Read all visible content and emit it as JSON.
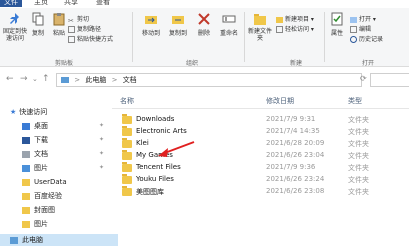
{
  "menu": {
    "tabs": [
      "文件",
      "主页",
      "共享",
      "查看"
    ]
  },
  "ribbon": {
    "pin_label": "固定到快速访问",
    "copy_label": "复制",
    "paste_label": "粘贴",
    "copy_path_label": "复制路径",
    "paste_shortcut_label": "粘贴快捷方式",
    "cut_label": "剪切",
    "clipboard_group": "剪贴板",
    "move_to_label": "移动到",
    "copy_to_label": "复制到",
    "delete_label": "删除",
    "rename_label": "重命名",
    "organize_group": "组织",
    "new_folder_label": "新建文件夹",
    "new_item_label": "新建项目",
    "easy_access_label": "轻松访问",
    "new_group": "新建",
    "properties_label": "属性",
    "open_label": "打开",
    "edit_label": "编辑",
    "history_label": "历史记录",
    "open_group": "打开"
  },
  "address": {
    "path1": "此电脑",
    "path2": "文档",
    "separator": ">"
  },
  "nav": {
    "items": [
      {
        "label": "快速访问"
      },
      {
        "label": "桌面"
      },
      {
        "label": "下载"
      },
      {
        "label": "文档"
      },
      {
        "label": "图片"
      },
      {
        "label": "UserData"
      },
      {
        "label": "百度经验"
      },
      {
        "label": "封面图"
      },
      {
        "label": "图片"
      },
      {
        "label": "此电脑"
      }
    ]
  },
  "columns": {
    "name": "名称",
    "date": "修改日期",
    "type": "类型"
  },
  "files": [
    {
      "name": "Downloads",
      "date": "2021/7/9 9:31",
      "type": "文件夹"
    },
    {
      "name": "Electronic Arts",
      "date": "2021/7/4 14:35",
      "type": "文件夹"
    },
    {
      "name": "Klei",
      "date": "2021/6/28 20:09",
      "type": "文件夹"
    },
    {
      "name": "My Games",
      "date": "2021/6/26 23:04",
      "type": "文件夹"
    },
    {
      "name": "Tencent Files",
      "date": "2021/7/9 9:36",
      "type": "文件夹"
    },
    {
      "name": "Youku Files",
      "date": "2021/6/26 23:24",
      "type": "文件夹"
    },
    {
      "name": "美图图库",
      "date": "2021/6/26 23:08",
      "type": "文件夹"
    }
  ],
  "colors": {
    "accent": "#2b579a",
    "folder": "#f0c74a",
    "arrow": "#e02020"
  }
}
